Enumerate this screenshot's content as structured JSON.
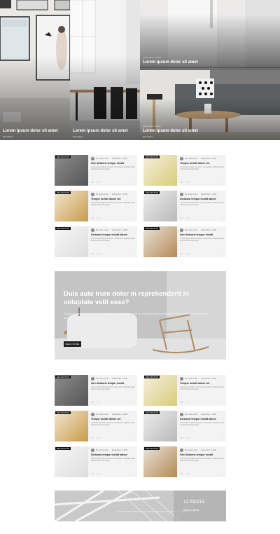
{
  "hero": {
    "tiles": [
      {
        "meta": "",
        "title": "Lorem ipsum dolor sit amet",
        "category": "Decoration"
      },
      {
        "meta": "",
        "title": "Lorem ipsum dolor sit amet",
        "category": "Decoration"
      },
      {
        "meta": "September 1, 2020",
        "title": "Lorem ipsum dolor sit amet",
        "category": ""
      },
      {
        "meta": "September 1, 2020",
        "title": "Lorem ipsum dolor sit amet",
        "category": "Decoration"
      }
    ]
  },
  "grid1": [
    {
      "badge": "DECORATION",
      "author": "By Jessie Levin",
      "date": "September 1, 2020",
      "title": "Sed dictumst tempor Incidit",
      "excerpt": "Lorem ipsum dolor sit amet, consectetur adipiscing elit, sed do eiusmod tempor",
      "comments": "0",
      "likes": "0"
    },
    {
      "badge": "DECORATION",
      "author": "By Jessie Levin",
      "date": "September 1, 2020",
      "title": "Tempor Incidit labore set",
      "excerpt": "Lorem ipsum dolor sit amet, consectetur adipiscing elit, sed do eiusmod tempor",
      "comments": "0",
      "likes": "0"
    },
    {
      "badge": "DECORATION",
      "author": "By Jessie Levin",
      "date": "September 1, 2020",
      "title": "Tempor Incidit labore set",
      "excerpt": "Lorem ipsum dolor sit amet, consectetur adipiscing elit, sed do eiusmod tempor",
      "comments": "0",
      "likes": "0"
    },
    {
      "badge": "DECORATION",
      "author": "By Jessie Levin",
      "date": "September 1, 2020",
      "title": "Dictumst tempor Incidit labore",
      "excerpt": "Lorem ipsum dolor sit amet, consectetur adipiscing elit, sed do eiusmod tempor",
      "comments": "0",
      "likes": "0"
    },
    {
      "badge": "DECORATION",
      "author": "By Jessie Levin",
      "date": "September 1, 2020",
      "title": "Dictumst tempor Incidit labore",
      "excerpt": "Lorem ipsum dolor sit amet, consectetur adipiscing elit, sed do eiusmod tempor",
      "comments": "0",
      "likes": "0"
    },
    {
      "badge": "DECORATION",
      "author": "By Jessie Levin",
      "date": "September 1, 2020",
      "title": "Sed dictumst tempor Incidit",
      "excerpt": "Lorem ipsum dolor sit amet, consectetur adipiscing elit, sed do eiusmod tempor",
      "comments": "0",
      "likes": "0"
    }
  ],
  "feature": {
    "heading": "Duis aute irure dolor in reprehenderit in voluptate velit esse?",
    "text": "Lorem ipsum dolor sit amet, consectetur adipiscing elit, sed do eiusmod tempor incididunt ut labore et dolore magna aliqua. Ut enim ad minim veniam.",
    "author": "By Jessie Levin",
    "button": "READ MORE"
  },
  "grid2": [
    {
      "badge": "DECORATION",
      "author": "By Jessie Levin",
      "date": "September 1, 2020",
      "title": "Sed dictumst tempor Incidit",
      "excerpt": "Lorem ipsum dolor sit amet, consectetur adipiscing elit, sed do eiusmod tempor",
      "comments": "0",
      "likes": "0"
    },
    {
      "badge": "DECORATION",
      "author": "By Jessie Levin",
      "date": "September 1, 2020",
      "title": "Tempor Incidit labore set",
      "excerpt": "Lorem ipsum dolor sit amet, consectetur adipiscing elit, sed do eiusmod tempor",
      "comments": "0",
      "likes": "0"
    },
    {
      "badge": "DECORATION",
      "author": "By Jessie Levin",
      "date": "September 1, 2020",
      "title": "Tempor Incidit labore set",
      "excerpt": "Lorem ipsum dolor sit amet, consectetur adipiscing elit, sed do eiusmod tempor",
      "comments": "0",
      "likes": "0"
    },
    {
      "badge": "DECORATION",
      "author": "By Jessie Levin",
      "date": "September 1, 2020",
      "title": "Dictumst tempor Incidit labore",
      "excerpt": "Lorem ipsum dolor sit amet, consectetur adipiscing elit, sed do eiusmod tempor",
      "comments": "0",
      "likes": "0"
    },
    {
      "badge": "DECORATION",
      "author": "By Jessie Levin",
      "date": "September 1, 2020",
      "title": "Dictumst tempor Incidit labore",
      "excerpt": "Lorem ipsum dolor sit amet, consectetur adipiscing elit, sed do eiusmod tempor",
      "comments": "0",
      "likes": "0"
    },
    {
      "badge": "DECORATION",
      "author": "By Jessie Levin",
      "date": "September 1, 2020",
      "title": "Sed dictumst tempor Incidit",
      "excerpt": "Lorem ipsum dolor sit amet, consectetur adipiscing elit, sed do eiusmod tempor",
      "comments": "0",
      "likes": "0"
    }
  ],
  "banner": {
    "size": "1170x210",
    "label": "Banner Area"
  }
}
